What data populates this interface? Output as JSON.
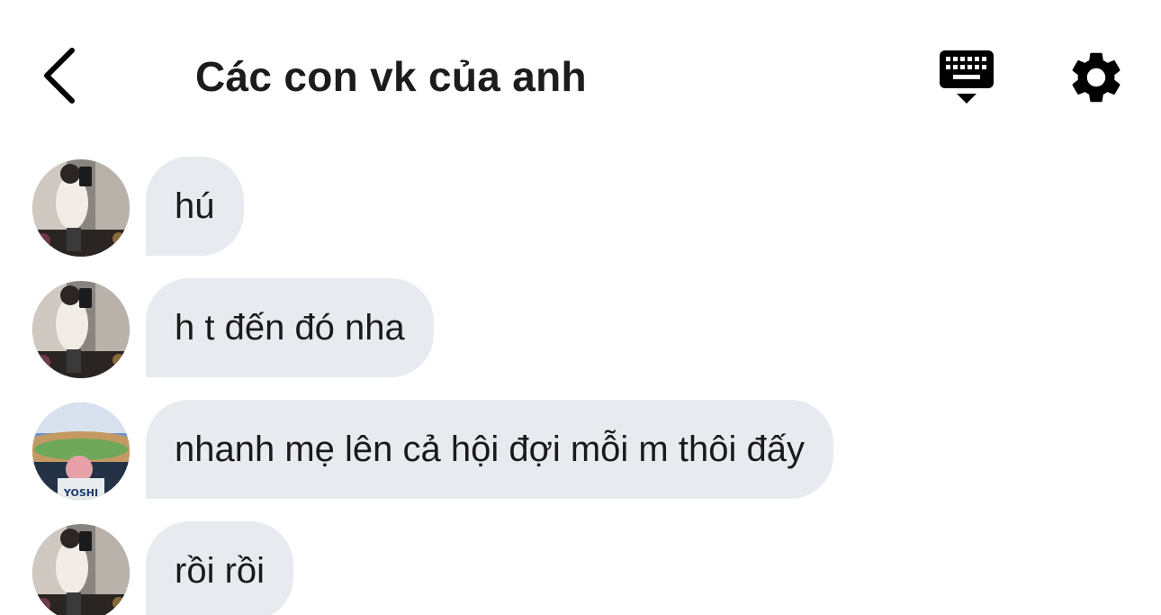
{
  "header": {
    "title": "Các con vk của anh",
    "back_icon": "chevron-left-icon",
    "keyboard_icon": "keyboard-icon",
    "settings_icon": "gear-icon"
  },
  "messages": [
    {
      "text": "hú",
      "avatar": "user-a"
    },
    {
      "text": "h t đến đó nha",
      "avatar": "user-a"
    },
    {
      "text": "nhanh mẹ lên cả hội đợi mỗi m thôi đấy",
      "avatar": "user-b"
    },
    {
      "text": "rồi rồi",
      "avatar": "user-a"
    }
  ],
  "avatars": {
    "user_b_shirt_text": "YOSHI"
  },
  "colors": {
    "bubble": "#e7ebef",
    "text": "#1a1a1a",
    "icon": "#000000"
  }
}
